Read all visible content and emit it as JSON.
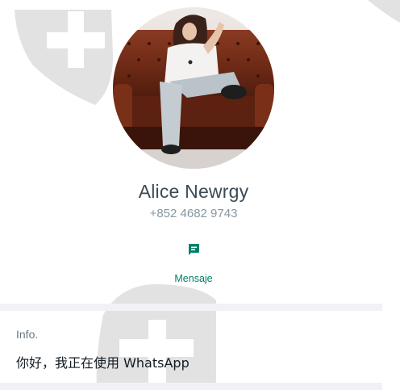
{
  "contact": {
    "name": "Alice Newrgy",
    "phone": "+852 4682 9743",
    "avatar_icon": "profile-photo"
  },
  "actions": {
    "message_label": "Mensaje",
    "message_icon": "message-icon"
  },
  "about": {
    "label": "Info.",
    "text": "你好，我正在使用 WhatsApp"
  },
  "colors": {
    "accent": "#008069",
    "name_text": "#3b4a54",
    "secondary_text": "#8696a0",
    "divider": "#f0f2f5",
    "watermark": "#e3e3e3"
  }
}
